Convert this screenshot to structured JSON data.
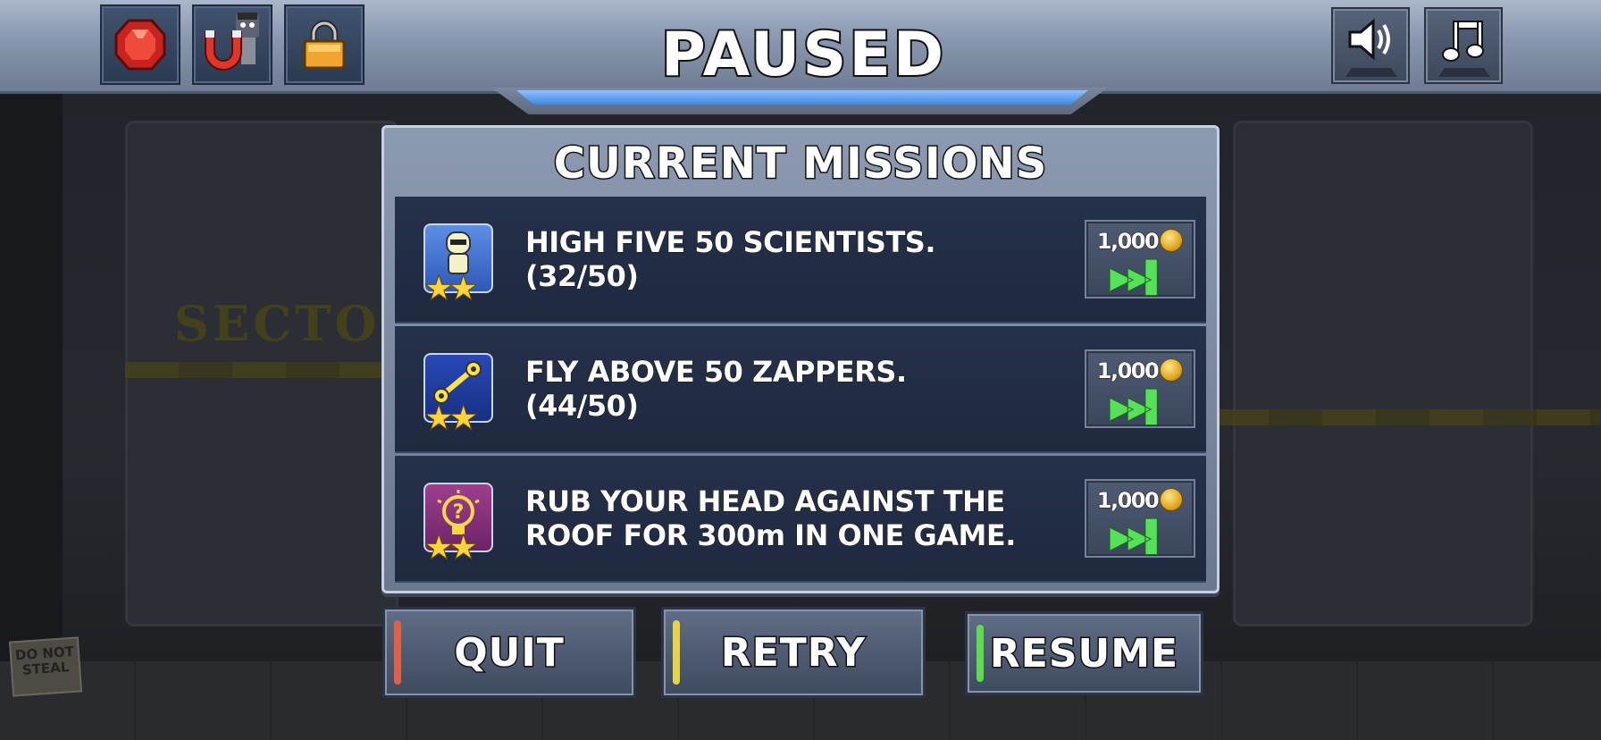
{
  "scene": {
    "sector_text": "SECTOR",
    "sign_text": "DO NOT STEAL"
  },
  "header": {
    "title": "PAUSED",
    "powerups": [
      {
        "icon": "gem-icon"
      },
      {
        "icon": "magnet-icon"
      },
      {
        "icon": "lock-icon",
        "locked": true
      }
    ],
    "controls": [
      {
        "icon": "volume-icon",
        "glyph": "🔊"
      },
      {
        "icon": "music-note-icon",
        "glyph": "♫"
      }
    ]
  },
  "missions": {
    "title": "CURRENT MISSIONS",
    "items": [
      {
        "text": "HIGH FIVE 50 SCIENTISTS. (32/50)",
        "progress": 32,
        "goal": 50,
        "stars": "★★",
        "icon": "scientist-icon",
        "skip_cost": "1,000"
      },
      {
        "text": "FLY ABOVE 50 ZAPPERS. (44/50)",
        "progress": 44,
        "goal": 50,
        "stars": "★★",
        "icon": "zapper-icon",
        "skip_cost": "1,000"
      },
      {
        "text": "RUB YOUR HEAD AGAINST THE ROOF FOR 300m IN ONE GAME.",
        "stars": "★★",
        "icon": "mystery-lightbulb-icon",
        "skip_cost": "1,000"
      }
    ],
    "skip_glyph": "▶▶▌"
  },
  "actions": {
    "quit": "QUIT",
    "retry": "RETRY",
    "resume": "RESUME"
  },
  "colors": {
    "quit_accent": "#e0604a",
    "retry_accent": "#e8d24a",
    "resume_accent": "#5fdc4e",
    "skip_arrow": "#57e05a",
    "header_glow": "#4f97f0"
  }
}
